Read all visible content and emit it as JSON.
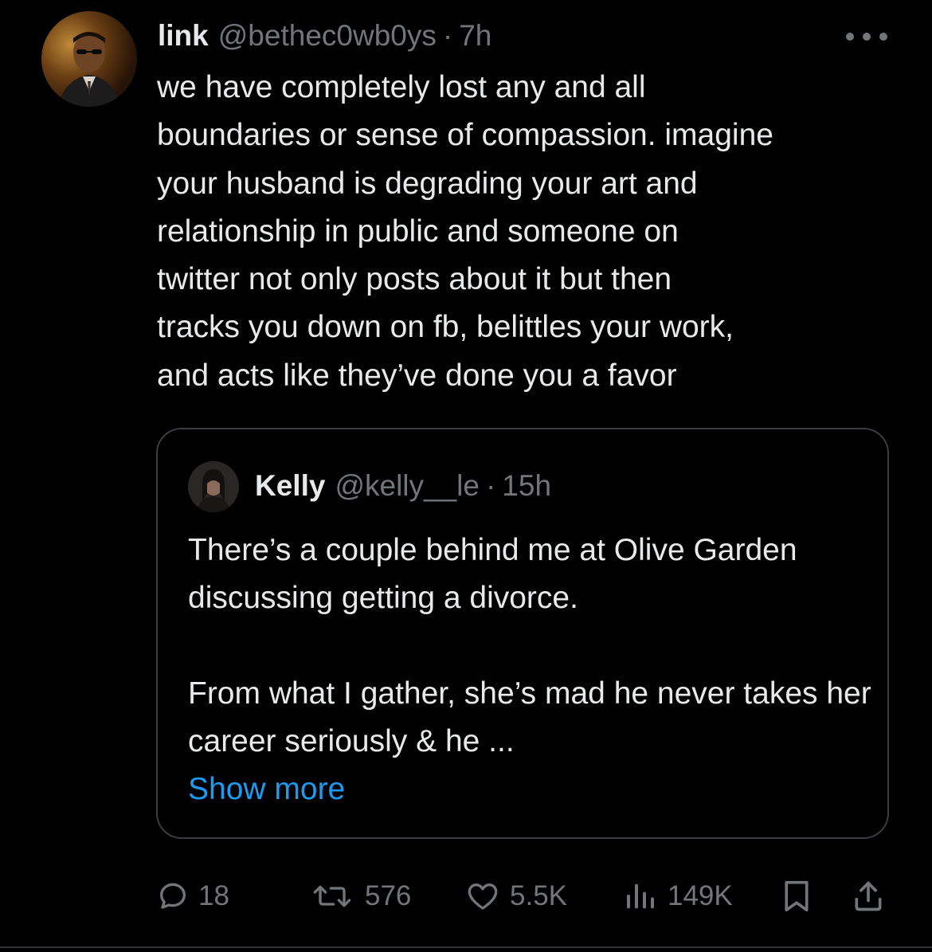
{
  "tweet": {
    "author_name": "link",
    "author_handle": "@bethec0wb0ys",
    "separator": "·",
    "time": "7h",
    "text": "we have completely lost any and all\nboundaries or sense of compassion. imagine\nyour husband is degrading your art and\nrelationship in public and someone on\ntwitter not only posts about it but then\ntracks you down on fb, belittles your work,\nand acts like they’ve done you a favor"
  },
  "quote": {
    "author_name": "Kelly",
    "author_handle": "@kelly__le",
    "separator": "·",
    "time": "15h",
    "paragraph_1": "There’s a couple behind me at Olive Garden discussing getting a divorce.",
    "paragraph_2": "From what I gather, she’s mad he never takes her career seriously & he ...",
    "show_more": "Show more"
  },
  "actions": {
    "replies": "18",
    "reposts": "576",
    "likes": "5.5K",
    "views": "149K"
  },
  "colors": {
    "background": "#000000",
    "text_primary": "#e7e9ea",
    "text_secondary": "#71767b",
    "link_blue": "#1d9bf0",
    "border": "#3a3d41"
  },
  "icons": {
    "more": "more-dots-icon",
    "reply": "reply-bubble-icon",
    "repost": "repost-arrows-icon",
    "like": "heart-icon",
    "views": "bar-chart-icon",
    "bookmark": "bookmark-icon",
    "share": "share-upload-icon"
  }
}
